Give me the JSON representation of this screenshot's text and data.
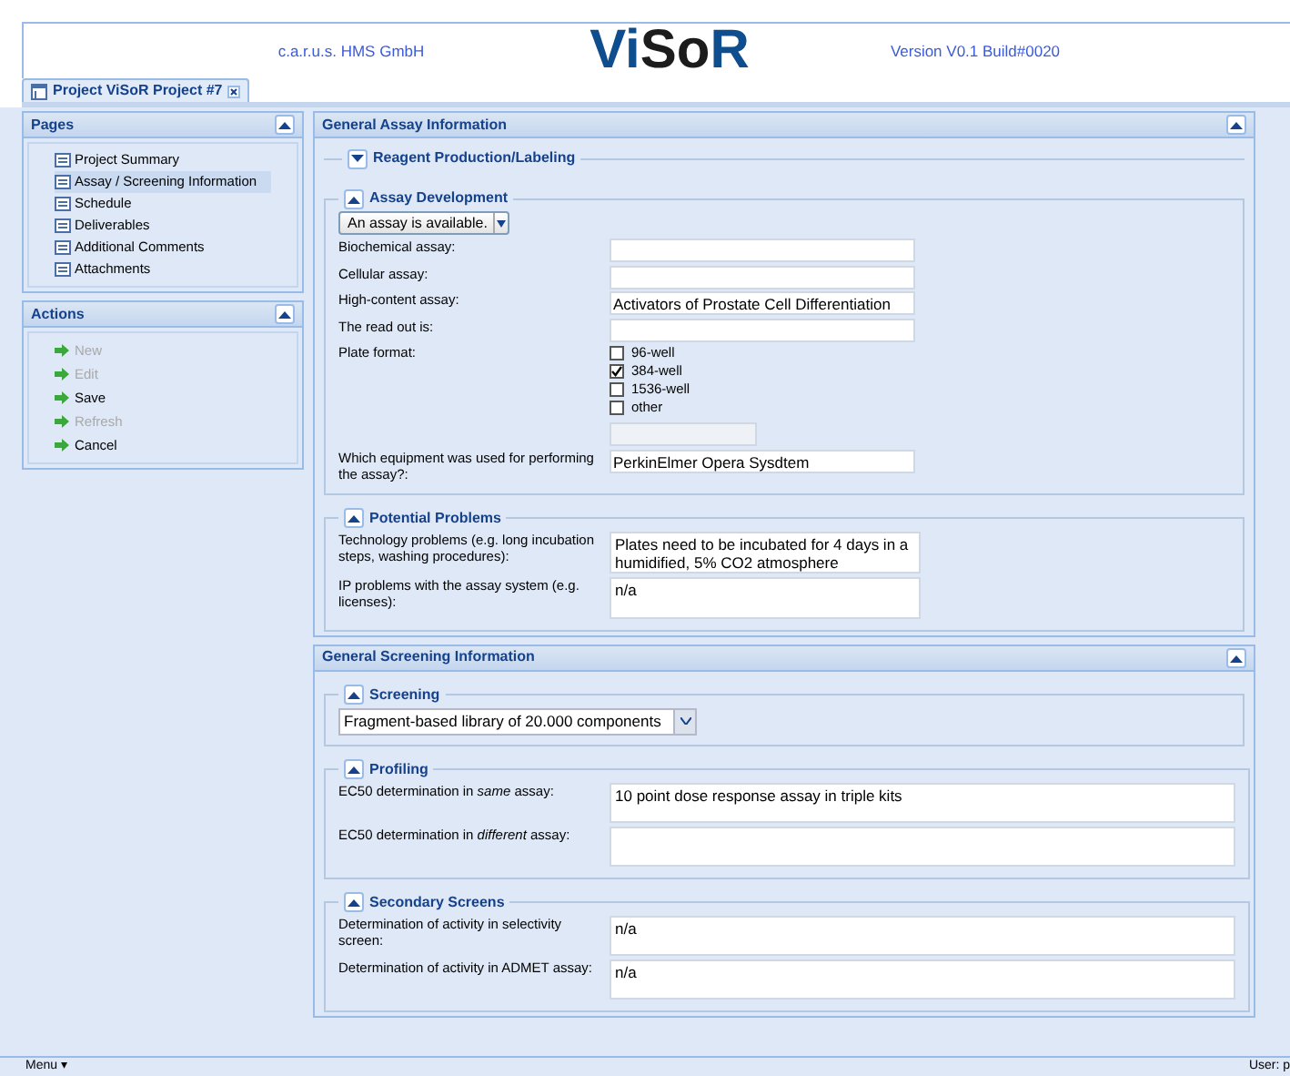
{
  "header": {
    "company": "c.a.r.u.s. HMS GmbH",
    "logo": [
      {
        "text": "Vi",
        "color": "#0e4d8e"
      },
      {
        "text": "So",
        "color": "#1c1c1c"
      },
      {
        "text": "R",
        "color": "#0e4d8e"
      }
    ],
    "version": "Version V0.1 Build#0020"
  },
  "tabs": [
    {
      "label": "Project ViSoR Project #7",
      "selected": true
    }
  ],
  "sidebar": [
    {
      "title": "Pages",
      "kind": "pages",
      "items": [
        {
          "label": "Project Summary",
          "selected": false
        },
        {
          "label": "Assay / Screening Information",
          "selected": true
        },
        {
          "label": "Schedule",
          "selected": false
        },
        {
          "label": "Deliverables",
          "selected": false
        },
        {
          "label": "Additional Comments",
          "selected": false
        },
        {
          "label": "Attachments",
          "selected": false
        }
      ]
    },
    {
      "title": "Actions",
      "kind": "actions",
      "items": [
        {
          "label": "New",
          "disabled": true
        },
        {
          "label": "Edit",
          "disabled": true
        },
        {
          "label": "Save",
          "disabled": false
        },
        {
          "label": "Refresh",
          "disabled": true
        },
        {
          "label": "Cancel",
          "disabled": false
        }
      ]
    }
  ],
  "sections": [
    {
      "title": "General Assay Information",
      "groups": [
        {
          "title": "Reagent Production/Labeling",
          "expanded": false
        },
        {
          "title": "Assay Development",
          "expanded": true,
          "rows": [
            {
              "kind": "menu",
              "value": "An assay is available."
            },
            {
              "kind": "text",
              "label": "Biochemical assay:"
            },
            {
              "kind": "text",
              "label": "Cellular assay:"
            },
            {
              "kind": "text",
              "label": "High-content assay:",
              "value": "Activators of Prostate Cell Differentiation"
            },
            {
              "kind": "text",
              "label": "The read out is:"
            },
            {
              "kind": "checkboxes",
              "label": "Plate format:",
              "other_disabled": true,
              "options": [
                {
                  "label": "96-well",
                  "checked": false
                },
                {
                  "label": "384-well",
                  "checked": true
                },
                {
                  "label": "1536-well",
                  "checked": false
                },
                {
                  "label": "other",
                  "checked": false
                }
              ]
            },
            {
              "kind": "text",
              "label": "Which equipment was used for performing the assay?:",
              "value": "PerkinElmer Opera Sysdtem"
            }
          ]
        },
        {
          "title": "Potential Problems",
          "expanded": true,
          "rows": [
            {
              "kind": "textarea",
              "label": "Technology problems (e.g. long incubation steps, washing procedures):",
              "value": "Plates need to be incubated for 4 days in a humidified, 5% CO2 atmosphere"
            },
            {
              "kind": "textarea",
              "label": "IP problems with the assay system (e.g. licenses):",
              "value": "n/a"
            }
          ]
        }
      ]
    },
    {
      "title": "General Screening Information",
      "groups": [
        {
          "title": "Screening",
          "expanded": true,
          "rows": [
            {
              "kind": "combo",
              "value": "Fragment-based library of 20.000 components"
            }
          ]
        },
        {
          "title": "Profiling",
          "expanded": true,
          "rows": [
            {
              "kind": "long-textarea",
              "label": "EC50 determination in *same* assay:",
              "value": "10 point dose response assay in triple kits"
            },
            {
              "kind": "long-textarea",
              "label": "EC50 determination in *different* assay:"
            }
          ]
        },
        {
          "title": "Secondary Screens",
          "expanded": true,
          "rows": [
            {
              "kind": "long-textarea",
              "label": "Determination of activity in selectivity screen:",
              "value": "n/a"
            },
            {
              "kind": "long-textarea",
              "label": "Determination of activity in ADMET assay:",
              "value": "n/a"
            }
          ]
        }
      ]
    }
  ],
  "status_bar": {
    "menu": "Menu ▾",
    "user": "User: p"
  }
}
